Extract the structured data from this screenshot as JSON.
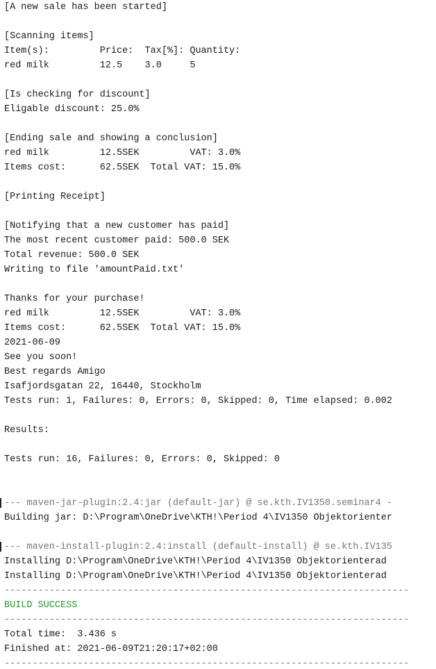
{
  "console": {
    "lines": [
      "[A new sale has been started]",
      "",
      "[Scanning items]",
      "Item(s):         Price:  Tax[%]: Quantity:",
      "red milk         12.5    3.0     5",
      "",
      "[Is checking for discount]",
      "Eligable discount: 25.0%",
      "",
      "[Ending sale and showing a conclusion]",
      "red milk         12.5SEK         VAT: 3.0%",
      "Items cost:      62.5SEK  Total VAT: 15.0%",
      "",
      "[Printing Receipt]",
      "",
      "[Notifying that a new customer has paid]",
      "The most recent customer paid: 500.0 SEK",
      "Total revenue: 500.0 SEK",
      "Writing to file 'amountPaid.txt'",
      "",
      "Thanks for your purchase!",
      "red milk         12.5SEK         VAT: 3.0%",
      "Items cost:      62.5SEK  Total VAT: 15.0%",
      "2021-06-09",
      "See you soon!",
      "Best regards Amigo",
      "Isafjordsgatan 22, 16440, Stockholm",
      "Tests run: 1, Failures: 0, Errors: 0, Skipped: 0, Time elapsed: 0.002",
      "",
      "Results:",
      "",
      "Tests run: 16, Failures: 0, Errors: 0, Skipped: 0",
      "",
      "",
      "--- maven-jar-plugin:2.4:jar (default-jar) @ se.kth.IV1350.seminar4 -",
      "Building jar: D:\\Program\\OneDrive\\KTH!\\Period 4\\IV1350 Objektorienter",
      "",
      "--- maven-install-plugin:2.4:install (default-install) @ se.kth.IV135",
      "Installing D:\\Program\\OneDrive\\KTH!\\Period 4\\IV1350 Objektorienterad",
      "Installing D:\\Program\\OneDrive\\KTH!\\Period 4\\IV1350 Objektorienterad",
      "------------------------------------------------------------------------",
      "BUILD SUCCESS",
      "------------------------------------------------------------------------",
      "Total time:  3.436 s",
      "Finished at: 2021-06-09T21:20:17+02:00",
      "------------------------------------------------------------------------"
    ]
  },
  "colors": {
    "text": "#1a1a1a",
    "separator": "#777777",
    "success": "#2a9a2a",
    "background": "#ffffff"
  }
}
